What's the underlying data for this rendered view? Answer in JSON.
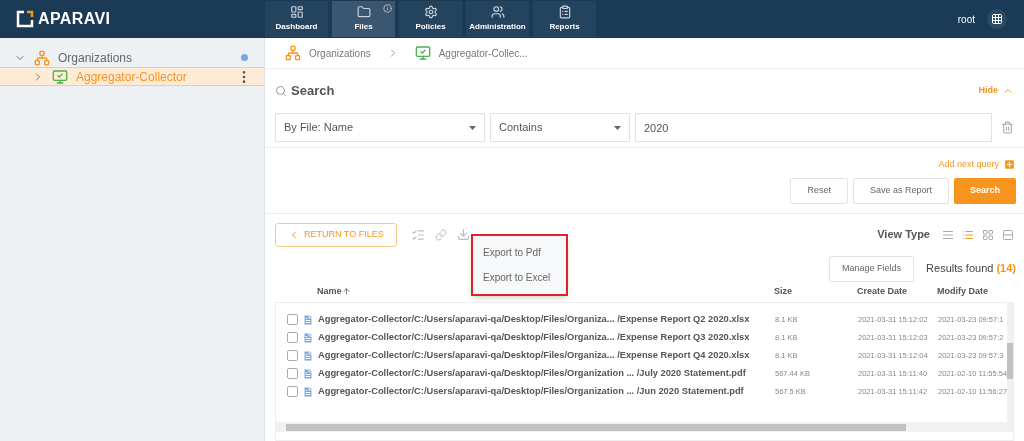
{
  "header": {
    "logo": "APARAVI",
    "user": "root",
    "nav": [
      {
        "label": "Dashboard",
        "selected": false,
        "info": false
      },
      {
        "label": "Files",
        "selected": true,
        "info": true
      },
      {
        "label": "Policies",
        "selected": false,
        "info": false
      },
      {
        "label": "Administration",
        "selected": false,
        "info": false
      },
      {
        "label": "Reports",
        "selected": false,
        "info": false
      }
    ]
  },
  "sidebar": {
    "tree": [
      {
        "label": "Organizations",
        "expanded": true,
        "selected": false,
        "children": [
          {
            "label": "Aggregator-Collector",
            "expanded": false,
            "selected": true
          }
        ]
      }
    ]
  },
  "breadcrumb": [
    {
      "label": "Organizations"
    },
    {
      "label": "Aggregator-Collec..."
    }
  ],
  "search": {
    "title": "Search",
    "toggle": "Hide",
    "field": "By File: Name",
    "operator": "Contains",
    "value": "2020",
    "add_query": "Add next query",
    "buttons": [
      {
        "label": "Reset",
        "primary": false
      },
      {
        "label": "Save as Report",
        "primary": false
      },
      {
        "label": "Search",
        "primary": true
      }
    ]
  },
  "results": {
    "return": "RETURN TO FILES",
    "view_type_label": "View Type",
    "view_types": [
      {
        "selected": false
      },
      {
        "selected": true
      },
      {
        "selected": false
      },
      {
        "selected": false
      }
    ],
    "menu": [
      "Export to Pdf",
      "Export to Excel"
    ],
    "manage_fields": "Manage Fields",
    "found_label": "Results found",
    "found_count": "(14)",
    "columns": [
      "Name",
      "Size",
      "Create Date",
      "Modify Date"
    ],
    "rows": [
      {
        "name": "Aggregator-Collector/C:/Users/aparavi-qa/Desktop/Files/Organiza... /Expense Report Q2 2020.xlsx",
        "size": "8.1 KB",
        "created": "2021-03-31 15:12:02",
        "modified": "2021-03-23 09:57:1",
        "checked": false
      },
      {
        "name": "Aggregator-Collector/C:/Users/aparavi-qa/Desktop/Files/Organiza... /Expense Report Q3 2020.xlsx",
        "size": "8.1 KB",
        "created": "2021-03-31 15:12:03",
        "modified": "2021-03-23 09:57:2",
        "checked": false
      },
      {
        "name": "Aggregator-Collector/C:/Users/aparavi-qa/Desktop/Files/Organiza... /Expense Report Q4 2020.xlsx",
        "size": "8.1 KB",
        "created": "2021-03-31 15:12:04",
        "modified": "2021-03-23 09:57:3",
        "checked": false
      },
      {
        "name": "Aggregator-Collector/C:/Users/aparavi-qa/Desktop/Files/Organization ... /July 2020 Statement.pdf",
        "size": "567.44 KB",
        "created": "2021-03-31 15:11:40",
        "modified": "2021-02-10 11:55:54",
        "checked": false
      },
      {
        "name": "Aggregator-Collector/C:/Users/aparavi-qa/Desktop/Files/Organization ...  /Jun 2020 Statement.pdf",
        "size": "567.5 KB",
        "created": "2021-03-31 15:11:42",
        "modified": "2021-02-10 11:56:27",
        "checked": false
      }
    ]
  }
}
